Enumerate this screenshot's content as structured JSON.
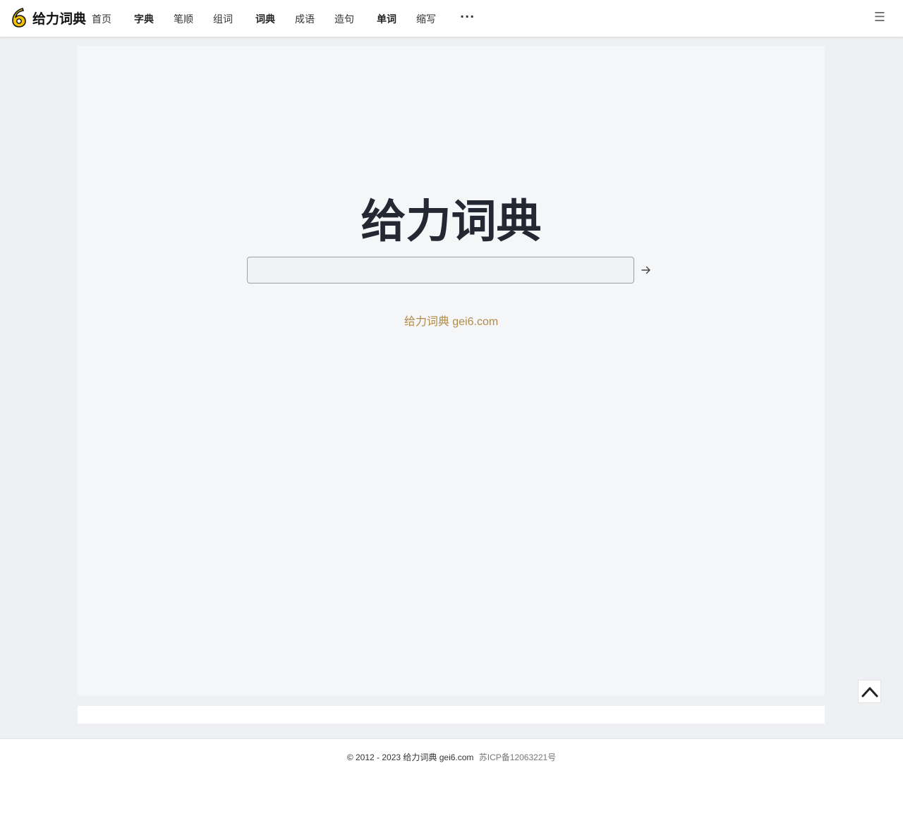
{
  "header": {
    "logo_text": "给力词典",
    "nav": [
      {
        "label": "首页",
        "bold": false
      },
      {
        "label": "字典",
        "bold": true
      },
      {
        "label": "笔顺",
        "bold": false
      },
      {
        "label": "组词",
        "bold": false
      },
      {
        "label": "词典",
        "bold": true
      },
      {
        "label": "成语",
        "bold": false
      },
      {
        "label": "造句",
        "bold": false
      },
      {
        "label": "单词",
        "bold": true
      },
      {
        "label": "缩写",
        "bold": false
      }
    ],
    "more_label": "···",
    "menu_icon": "☰"
  },
  "main": {
    "title": "给力词典",
    "search": {
      "value": "",
      "placeholder": ""
    },
    "tagline": "给力词典 gei6.com"
  },
  "footer": {
    "copyright": "© 2012 - 2023 给力词典 gei6.com",
    "icp": "苏ICP备12063221号"
  },
  "colors": {
    "accent": "#f2c200",
    "tagline": "#b08a4a",
    "title": "#232833",
    "page_bg": "#eef0f3"
  }
}
